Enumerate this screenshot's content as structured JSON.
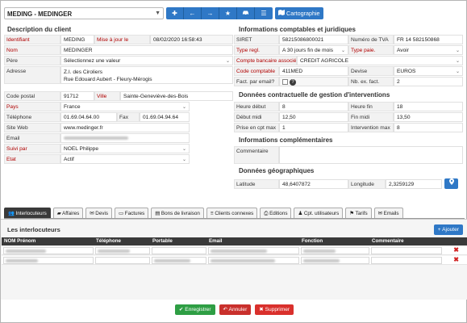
{
  "header": {
    "client_name": "MEDING - MEDINGER",
    "nav_icons": [
      "plus-icon",
      "arrow-left-icon",
      "arrow-right-icon",
      "star-icon",
      "car-icon",
      "menu-icon"
    ],
    "carto_label": "Cartographie"
  },
  "client": {
    "title": "Description du client",
    "identifiant_label": "Identifiant",
    "identifiant": "MEDING",
    "maj_label": "Mise à jour le",
    "maj": "08/02/2020 16:58:43",
    "nom_label": "Nom",
    "nom": "MEDINGER",
    "pere_label": "Père",
    "pere": "Sélectionnez une valeur",
    "adresse_label": "Adresse",
    "adresse_l1": "Z.I. des Ciroliers",
    "adresse_l2": "Rue Edouard Aubert - Fleury-Mérogis",
    "cp_label": "Code postal",
    "cp": "91712",
    "ville_label": "Ville",
    "ville": "Sainte-Geneviève-des-Bois",
    "pays_label": "Pays",
    "pays": "France",
    "tel_label": "Téléphone",
    "tel": "01.69.04.64.00",
    "fax_label": "Fax",
    "fax": "01.69.04.94.64",
    "web_label": "Site Web",
    "web": "www.medinger.fr",
    "email_label": "Email",
    "suivi_label": "Suivi par",
    "suivi": "NOEL Philippe",
    "etat_label": "Etat",
    "etat": "Actif"
  },
  "compta": {
    "title": "Informations comptables et juridiques",
    "siret_label": "SIRET",
    "siret": "58215086800021",
    "tva_label": "Numéro de TVA",
    "tva": "FR 14 582150868",
    "type_regl_label": "Type regl.",
    "type_regl": "A 30 jours fin de mois",
    "type_paie_label": "Type paie.",
    "type_paie": "Avoir",
    "compte_label": "Compte bancaire associé",
    "compte": "CREDIT AGRICOLE",
    "code_compta_label": "Code comptable",
    "code_compta": "411MED",
    "devise_label": "Devise",
    "devise": "EUROS",
    "fact_mail_label": "Fact. par email?",
    "nb_fact_label": "Nb. ex. fact.",
    "nb_fact": "2"
  },
  "interv": {
    "title": "Données contractuelle de gestion d'interventions",
    "heure_debut_label": "Heure début",
    "heure_debut": "8",
    "heure_fin_label": "Heure fin",
    "heure_fin": "18",
    "debut_midi_label": "Début midi",
    "debut_midi": "12,50",
    "fin_midi_label": "Fin midi",
    "fin_midi": "13,50",
    "prise_label": "Prise en cpt max",
    "prise": "1",
    "interv_max_label": "Intervention max",
    "interv_max": "8"
  },
  "compl": {
    "title": "Informations complémentaires",
    "commentaire_label": "Commentaire"
  },
  "geo": {
    "title": "Données géographiques",
    "lat_label": "Latitude",
    "lat": "48,6407872",
    "lng_label": "Longitude",
    "lng": "2,3259129"
  },
  "tabs": [
    {
      "label": "Interlocuteurs",
      "icon": "users-icon"
    },
    {
      "label": "Affaires",
      "icon": "folder-icon"
    },
    {
      "label": "Devis",
      "icon": "mail-icon"
    },
    {
      "label": "Factures",
      "icon": "invoice-icon"
    },
    {
      "label": "Bons de livraison",
      "icon": "truck-icon"
    },
    {
      "label": "Clients connexes",
      "icon": "list-icon"
    },
    {
      "label": "Editions",
      "icon": "print-icon"
    },
    {
      "label": "Cpt. utilisateurs",
      "icon": "user-icon"
    },
    {
      "label": "Tarifs",
      "icon": "tag-icon"
    },
    {
      "label": "Emails",
      "icon": "mail-icon"
    }
  ],
  "contacts": {
    "title": "Les interlocuteurs",
    "add_label": "Ajouter",
    "columns": [
      "NOM Prénom",
      "Téléphone",
      "Portable",
      "Email",
      "Fonction",
      "Commentaire"
    ],
    "row_count": 2
  },
  "actions": {
    "save": "Enregistrer",
    "cancel": "Annuler",
    "delete": "Supprimer"
  },
  "colors": {
    "accent": "#2f78c6",
    "required": "#b00000",
    "save": "#2e9e44",
    "delete": "#c9302c"
  }
}
